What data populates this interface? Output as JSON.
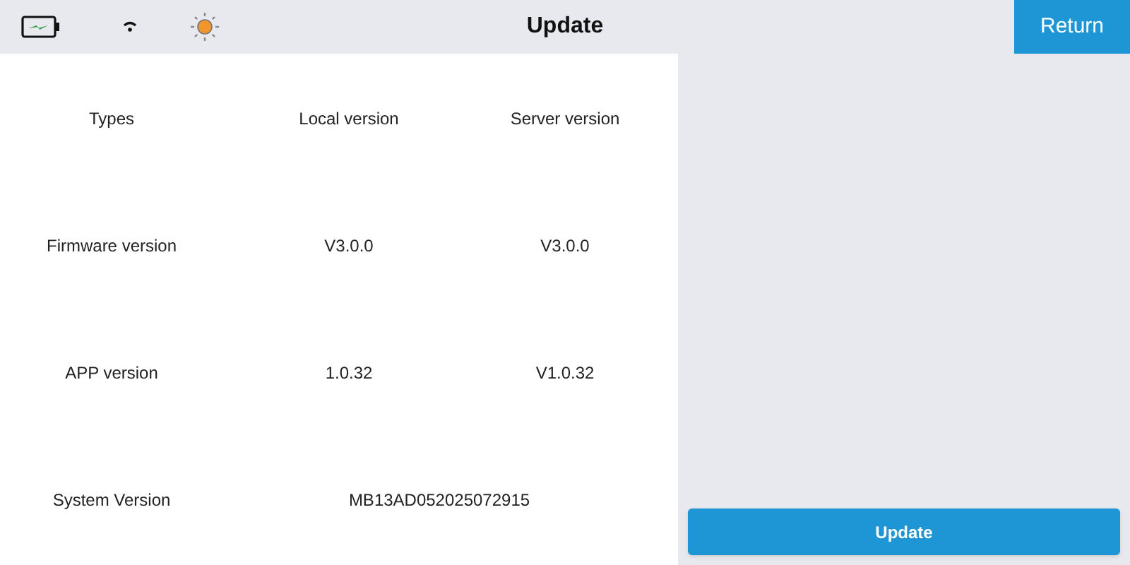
{
  "header": {
    "title": "Update",
    "return_button": "Return"
  },
  "table": {
    "columns": [
      "Types",
      "Local version",
      "Server version"
    ],
    "rows": [
      {
        "cells": [
          "Firmware version",
          "V3.0.0",
          "V3.0.0"
        ]
      },
      {
        "cells": [
          "APP version",
          "1.0.32",
          "V1.0.32"
        ]
      },
      {
        "cells": [
          "System Version",
          "MB13AD052025072915"
        ]
      }
    ]
  },
  "update_button": "Update"
}
